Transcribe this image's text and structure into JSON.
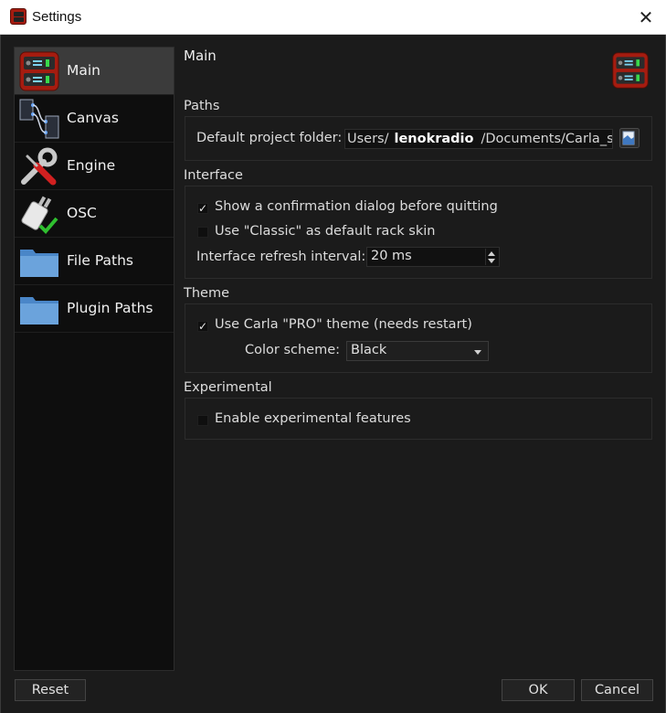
{
  "window": {
    "title": "Settings",
    "close_glyph": "✕"
  },
  "sidebar": {
    "items": [
      {
        "label": "Main",
        "icon": "carla-rack-icon",
        "active": true
      },
      {
        "label": "Canvas",
        "icon": "patchbay-canvas-icon",
        "active": false
      },
      {
        "label": "Engine",
        "icon": "tools-wrench-screwdriver-icon",
        "active": false
      },
      {
        "label": "OSC",
        "icon": "network-plug-check-icon",
        "active": false
      },
      {
        "label": "File Paths",
        "icon": "folder-icon",
        "active": false
      },
      {
        "label": "Plugin Paths",
        "icon": "folder-icon",
        "active": false
      }
    ]
  },
  "page": {
    "title": "Main",
    "icon": "carla-rack-icon"
  },
  "paths": {
    "title": "Paths",
    "default_folder_label": "Default project folder:",
    "folder_prefix": "Users/",
    "folder_user": "lenokradio",
    "folder_suffix": "/Documents/Carla_set",
    "browse_icon": "open-folder-icon"
  },
  "interface": {
    "title": "Interface",
    "confirm_quit_label": "Show a confirmation dialog before quitting",
    "confirm_quit_checked": true,
    "classic_skin_label": "Use \"Classic\" as default rack skin",
    "classic_skin_checked": false,
    "refresh_label": "Interface refresh interval:",
    "refresh_value": "20 ms"
  },
  "theme": {
    "title": "Theme",
    "pro_theme_label": "Use Carla \"PRO\" theme (needs restart)",
    "pro_theme_checked": true,
    "color_scheme_label": "Color scheme:",
    "color_scheme_value": "Black"
  },
  "experimental": {
    "title": "Experimental",
    "enable_label": "Enable experimental features",
    "enable_checked": false
  },
  "buttons": {
    "reset": "Reset",
    "ok": "OK",
    "cancel": "Cancel"
  },
  "glyphs": {
    "check": "✓"
  },
  "colors": {
    "background": "#1b1b1b",
    "sidebar_bg": "#0e0e0e",
    "active_item": "#3b3b3b",
    "carla_red": "#a51c10"
  }
}
